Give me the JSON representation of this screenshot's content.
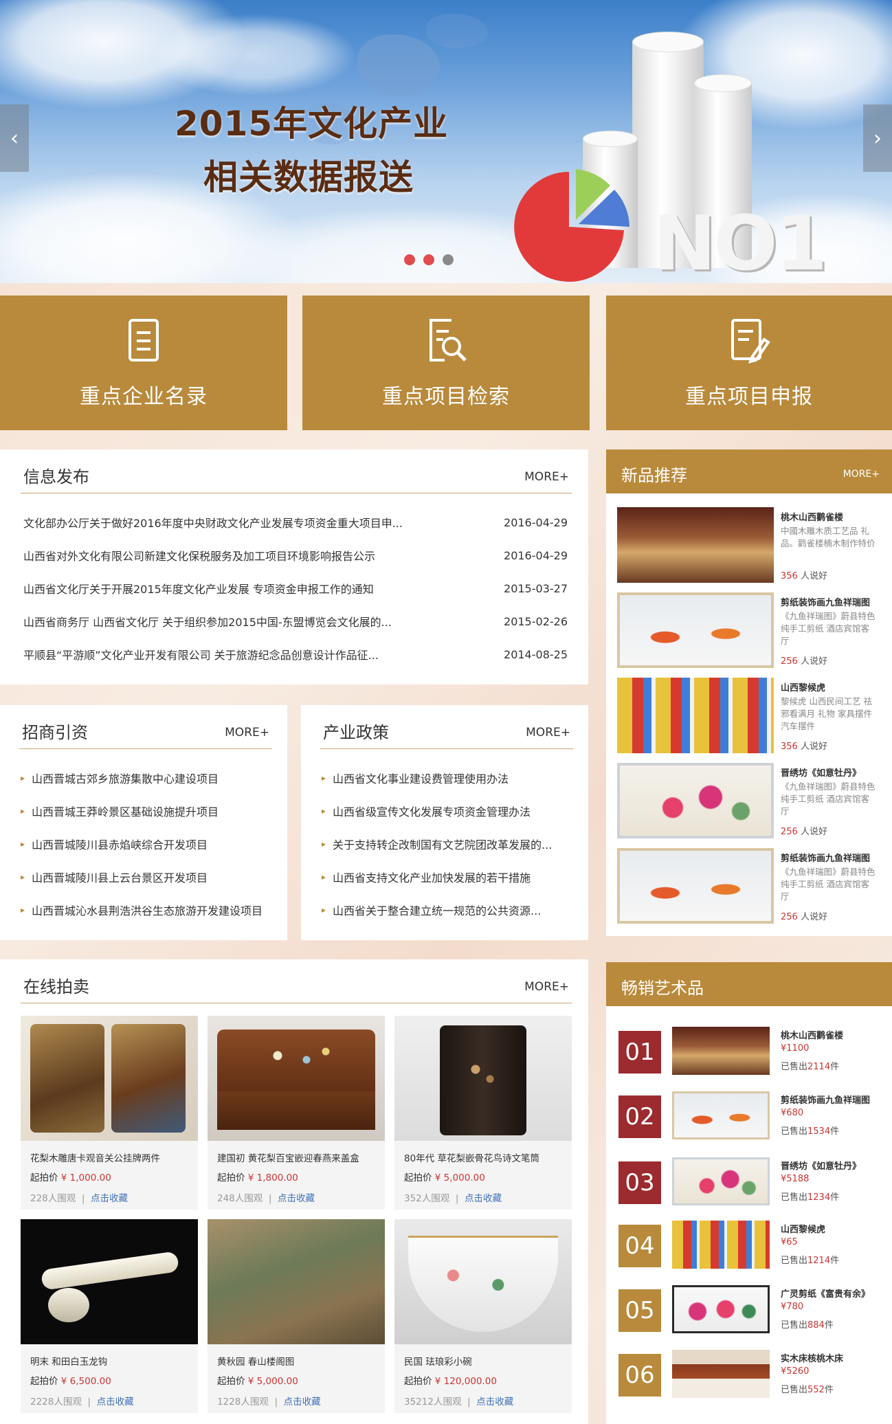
{
  "banner": {
    "title_line1": "2015年文化产业",
    "title_line2": "相关数据报送",
    "badge": "NO1",
    "prev": "‹",
    "next": "›"
  },
  "quick_links": [
    {
      "label": "重点企业名录",
      "icon": "document-icon"
    },
    {
      "label": "重点项目检索",
      "icon": "document-search-icon"
    },
    {
      "label": "重点项目申报",
      "icon": "document-edit-icon"
    }
  ],
  "news": {
    "title": "信息发布",
    "more": "MORE+",
    "items": [
      {
        "title": "文化部办公厅关于做好2016年度中央财政文化产业发展专项资金重大项目申...",
        "date": "2016-04-29"
      },
      {
        "title": "山西省对外文化有限公司新建文化保税服务及加工项目环境影响报告公示",
        "date": "2016-04-29"
      },
      {
        "title": "山西省文化厅关于开展2015年度文化产业发展 专项资金申报工作的通知",
        "date": "2015-03-27"
      },
      {
        "title": "山西省商务厅 山西省文化厅 关于组织参加2015中国-东盟博览会文化展的...",
        "date": "2015-02-26"
      },
      {
        "title": "平顺县“平游顺”文化产业开发有限公司 关于旅游纪念品创意设计作品征...",
        "date": "2014-08-25"
      }
    ]
  },
  "invest": {
    "title": "招商引资",
    "more": "MORE+",
    "items": [
      "山西晋城古郊乡旅游集散中心建设项目",
      "山西晋城王莽岭景区基础设施提升项目",
      "山西晋城陵川县赤焰峡综合开发项目",
      "山西晋城陵川县上云台景区开发项目",
      "山西晋城沁水县荆浩洪谷生态旅游开发建设项目"
    ]
  },
  "policy": {
    "title": "产业政策",
    "more": "MORE+",
    "items": [
      "山西省文化事业建设费管理使用办法",
      "山西省级宣传文化发展专项资金管理办法",
      "关于支持转企改制国有文艺院团改革发展的...",
      "山西省支持文化产业加快发展的若干措施",
      "山西省关于整合建立统一规范的公共资源..."
    ]
  },
  "new_products": {
    "title": "新品推荐",
    "more": "MORE+",
    "items": [
      {
        "name": "桃木山西鹳雀楼",
        "desc": "中國木雕木质工艺品 礼品。鹳雀楼楠木制作特价",
        "count": "356",
        "count_suffix": "人说好"
      },
      {
        "name": "剪纸装饰画九鱼祥瑞图",
        "desc": "《九鱼祥瑞图》蔚县特色纯手工剪纸 酒店宾馆客厅",
        "count": "256",
        "count_suffix": "人说好"
      },
      {
        "name": "山西黎候虎",
        "desc": "黎候虎 山西民间工艺 祛邪看满月 礼物 家具摆件 汽车摆件",
        "count": "356",
        "count_suffix": "人说好"
      },
      {
        "name": "晋绣坊《如意牡丹》",
        "desc": "《九鱼祥瑞图》蔚县特色纯手工剪纸 酒店宾馆客厅",
        "count": "256",
        "count_suffix": "人说好"
      },
      {
        "name": "剪纸装饰画九鱼祥瑞图",
        "desc": "《九鱼祥瑞图》蔚县特色纯手工剪纸 酒店宾馆客厅",
        "count": "256",
        "count_suffix": "人说好"
      }
    ]
  },
  "auction": {
    "title": "在线拍卖",
    "more": "MORE+",
    "price_label": "起拍价",
    "fav": "点击收藏",
    "sep": "|",
    "items": [
      {
        "name": "花梨木雕唐卡观音关公挂牌两件",
        "price": "¥ 1,000.00",
        "views": "228人围观"
      },
      {
        "name": "建国初 黄花梨百宝嵌迎春燕来盖盒",
        "price": "¥ 1,800.00",
        "views": "248人围观"
      },
      {
        "name": "80年代 草花梨嵌骨花鸟诗文笔筒",
        "price": "¥ 5,000.00",
        "views": "352人围观"
      },
      {
        "name": "明末 和田白玉龙钩",
        "price": "¥ 6,500.00",
        "views": "2228人围观"
      },
      {
        "name": "黄秋园 春山楼阁图",
        "price": "¥ 5,000.00",
        "views": "1228人围观"
      },
      {
        "name": "民国 珐琅彩小碗",
        "price": "¥ 120,000.00",
        "views": "35212人围观"
      }
    ]
  },
  "bestsellers": {
    "title": "畅销艺术品",
    "sold_prefix": "已售出",
    "sold_suffix": "件",
    "items": [
      {
        "rank": "01",
        "name": "桃木山西鹳雀楼",
        "price": "¥1100",
        "sold": "2114"
      },
      {
        "rank": "02",
        "name": "剪纸装饰画九鱼祥瑞图",
        "price": "¥680",
        "sold": "1534"
      },
      {
        "rank": "03",
        "name": "晋绣坊《如意牡丹》",
        "price": "¥5188",
        "sold": "1234"
      },
      {
        "rank": "04",
        "name": "山西黎候虎",
        "price": "¥65",
        "sold": "1214"
      },
      {
        "rank": "05",
        "name": "广灵剪纸《富贵有余》",
        "price": "¥780",
        "sold": "884"
      },
      {
        "rank": "06",
        "name": "实木床核桃木床",
        "price": "¥5260",
        "sold": "552"
      }
    ]
  },
  "colors": {
    "brand": "#b98a3b",
    "rank_red": "#9b2b2e",
    "rank_gold": "#b98a3b",
    "price_red": "#cc3333"
  }
}
